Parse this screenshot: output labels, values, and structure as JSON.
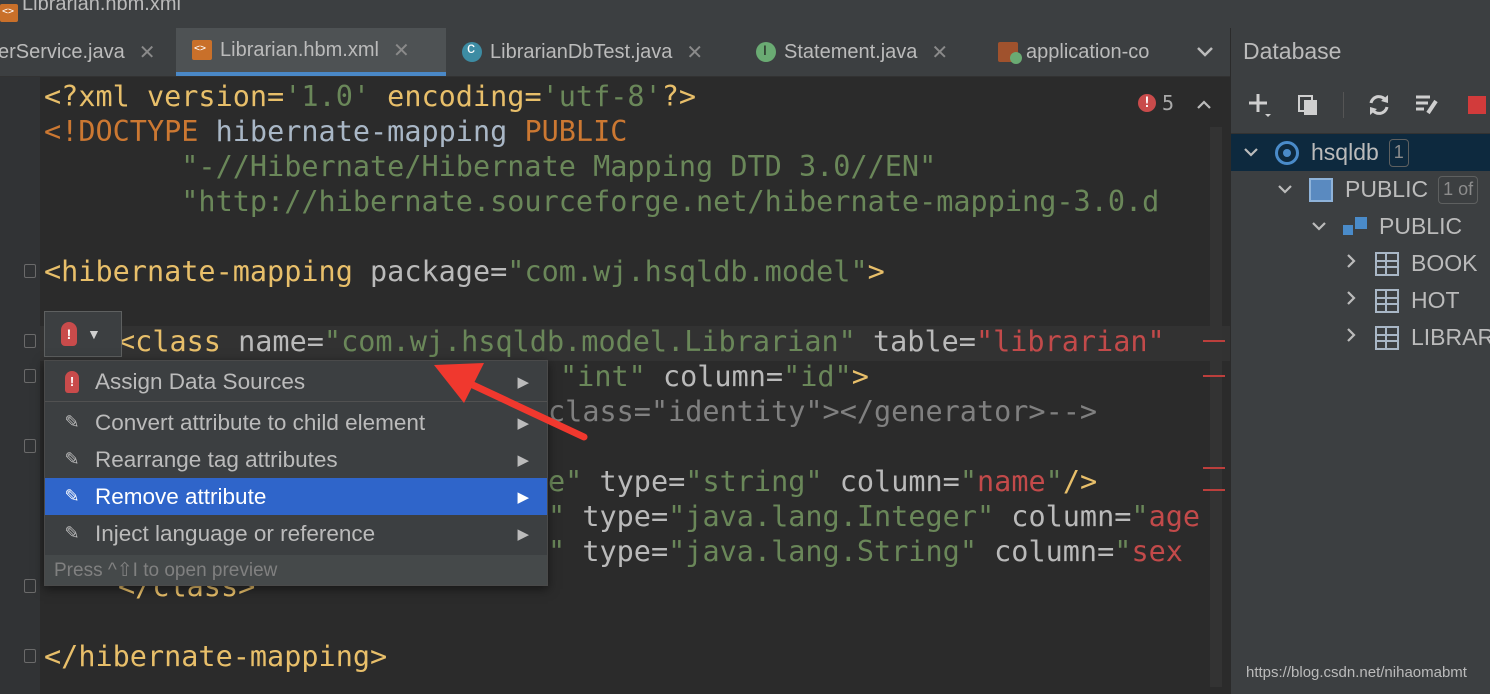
{
  "window": {
    "title": "Librarian.hbm.xml"
  },
  "tabs": [
    {
      "label": "erService.java",
      "icon": "java-class-icon"
    },
    {
      "label": "Librarian.hbm.xml",
      "icon": "xml-file-icon",
      "active": true
    },
    {
      "label": "LibrarianDbTest.java",
      "icon": "java-test-class-icon"
    },
    {
      "label": "Statement.java",
      "icon": "java-interface-icon"
    },
    {
      "label": "application-co",
      "icon": "spring-config-icon"
    }
  ],
  "tab_close_glyph": "✕",
  "inspection": {
    "error_count": "5"
  },
  "code": {
    "l1": {
      "a": "<?xml version=",
      "b": "'1.0'",
      "c": " encoding=",
      "d": "'utf-8'",
      "e": "?>"
    },
    "l2": {
      "a": "<!DOCTYPE ",
      "b": "hibernate-mapping ",
      "c": "PUBLIC"
    },
    "l3": "        \"-//Hibernate/Hibernate Mapping DTD 3.0//EN\"",
    "l4": "        \"http://hibernate.sourceforge.net/hibernate-mapping-3.0.d",
    "l6": {
      "a": "<hibernate-mapping",
      "b": " package=",
      "c": "\"com.wj.hsqldb.model\"",
      "d": ">"
    },
    "l8": {
      "a": "<class",
      "b": " name=",
      "c": "\"com.wj.hsqldb.model.Librarian\"",
      "d": " table=",
      "e": "\"librarian\""
    },
    "l9": {
      "a": "\"int\"",
      "b": " column=",
      "c": "\"id\"",
      "d": ">"
    },
    "l10": "class=\"identity\"></generator>-->",
    "l12": {
      "a": "e\"",
      "b": " type=",
      "c": "\"string\"",
      "d": " column=",
      "e": "\"",
      "f": "name",
      "g": "\"",
      "h": "/>"
    },
    "l13": {
      "a": "\"",
      "b": " type=",
      "c": "\"java.lang.Integer\"",
      "d": " column=",
      "e": "\"",
      "f": "age"
    },
    "l14": {
      "a": "\"",
      "b": " type=",
      "c": "\"java.lang.String\"",
      "d": " column=",
      "e": "\"",
      "f": "sex"
    },
    "l15": "</class>",
    "l17": "</hibernate-mapping>"
  },
  "popup": {
    "items": [
      {
        "label": "Assign Data Sources",
        "icon": "error-bulb-icon"
      },
      {
        "label": "Convert attribute to child element",
        "icon": "intention-icon"
      },
      {
        "label": "Rearrange tag attributes",
        "icon": "intention-icon"
      },
      {
        "label": "Remove attribute",
        "icon": "intention-icon",
        "selected": true
      },
      {
        "label": "Inject language or reference",
        "icon": "intention-icon"
      }
    ],
    "hint": "Press ^⇧I to open preview"
  },
  "database": {
    "title": "Database",
    "tree": [
      {
        "label": "hsqldb",
        "badge": "1",
        "expanded": true,
        "icon": "hsqldb-datasource-icon"
      },
      {
        "label": "PUBLIC",
        "badge": "1 of",
        "expanded": true,
        "icon": "database-icon"
      },
      {
        "label": "PUBLIC",
        "expanded": true,
        "icon": "schema-icon"
      },
      {
        "label": "BOOK",
        "icon": "table-icon"
      },
      {
        "label": "HOT",
        "icon": "table-icon"
      },
      {
        "label": "LIBRAR",
        "icon": "table-icon"
      }
    ]
  },
  "watermark": "https://blog.csdn.net/nihaomabmt",
  "colors": {
    "accent": "#2f65ca",
    "error": "#c94b4b",
    "tag": "#e8bf6a",
    "string": "#6a8759",
    "arrow": "#f0382e"
  }
}
